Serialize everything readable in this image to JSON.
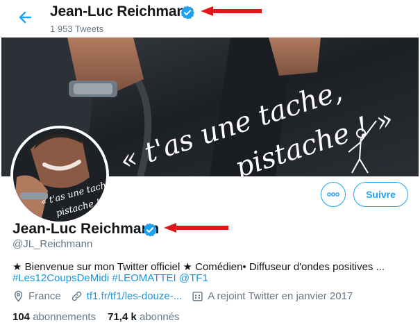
{
  "header": {
    "name": "Jean-Luc Reichmann",
    "tweet_count": "1 953 Tweets"
  },
  "banner": {
    "script_line1": "« t'as une tache,",
    "script_line2": "pistache ! »"
  },
  "avatar": {
    "script_line1": "« t'as une tache,",
    "script_line2": "pistache ! »"
  },
  "actions": {
    "more_label": "◦◦◦",
    "follow_label": "Suivre"
  },
  "profile": {
    "name": "Jean-Luc Reichmann",
    "handle": "@JL_Reichmann",
    "bio": "★ Bienvenue sur mon Twitter officiel ★ Comédien• Diffuseur d'ondes positives ...",
    "tags": [
      "#Les12CoupsDeMidi",
      "#LEOMATTEI",
      "@TF1"
    ],
    "location": "France",
    "website": "tf1.fr/tf1/les-douze-...",
    "joined": "A rejoint Twitter en janvier 2017",
    "following_count": "104",
    "following_label": "abonnements",
    "followers_count": "71,4 k",
    "followers_label": "abonnés"
  },
  "colors": {
    "accent": "#1da1f2",
    "annotation_arrow": "#e0171a",
    "verified": "#1da1f2",
    "muted": "#657786"
  },
  "icons": {
    "back": "arrow-left-icon",
    "verified": "verified-badge-icon",
    "location": "location-pin-icon",
    "link": "link-icon",
    "calendar": "calendar-icon"
  }
}
